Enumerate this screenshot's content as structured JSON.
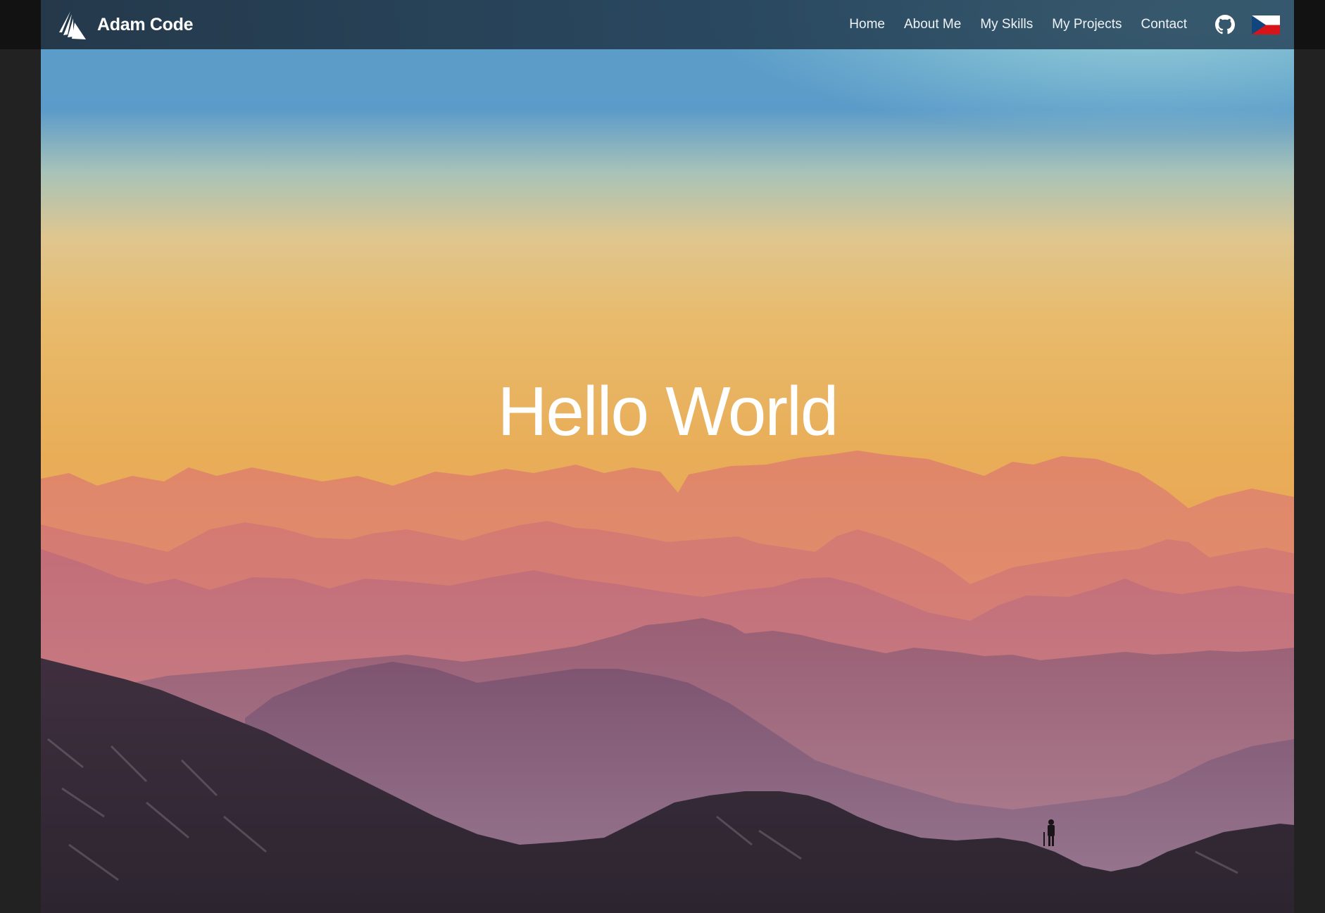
{
  "brand": {
    "name": "Adam Code",
    "logo_icon": "stacked-sails-logo-icon"
  },
  "nav": {
    "items": [
      {
        "label": "Home"
      },
      {
        "label": "About Me"
      },
      {
        "label": "My Skills"
      },
      {
        "label": "My Projects"
      },
      {
        "label": "Contact"
      }
    ],
    "github_icon": "github-icon",
    "language_icon": "czech-flag-icon"
  },
  "hero": {
    "title": "Hello World",
    "background": "mountain-sunset-image"
  },
  "colors": {
    "navbar": "#233a4f",
    "sky_top": "#5a9cc8",
    "sky_mid": "#e9b35f",
    "hero_text": "#ffffff",
    "page_background": "#222222"
  }
}
